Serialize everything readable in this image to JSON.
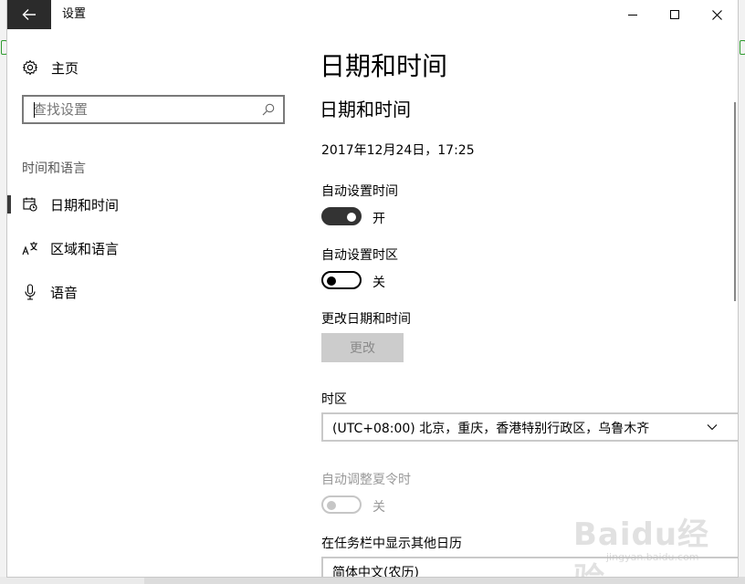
{
  "window": {
    "title": "设置"
  },
  "nav": {
    "home_label": "主页",
    "search_placeholder": "查找设置",
    "section_title": "时间和语言",
    "items": [
      {
        "label": "日期和时间",
        "selected": true,
        "icon": "calendar-clock-icon"
      },
      {
        "label": "区域和语言",
        "selected": false,
        "icon": "language-icon"
      },
      {
        "label": "语音",
        "selected": false,
        "icon": "microphone-icon"
      }
    ]
  },
  "main": {
    "page_title": "日期和时间",
    "section_title": "日期和时间",
    "current_datetime": "2017年12月24日，17:25",
    "auto_time": {
      "label": "自动设置时间",
      "state": "开",
      "on": true
    },
    "auto_timezone": {
      "label": "自动设置时区",
      "state": "关",
      "on": false
    },
    "change_datetime": {
      "label": "更改日期和时间",
      "button": "更改",
      "enabled": false
    },
    "timezone": {
      "label": "时区",
      "value": "(UTC+08:00) 北京，重庆，香港特别行政区，乌鲁木齐"
    },
    "dst": {
      "label": "自动调整夏令时",
      "state": "关",
      "enabled": false
    },
    "extra_calendar": {
      "label": "在任务栏中显示其他日历",
      "value": "简体中文(农历)"
    }
  },
  "watermark": {
    "logo_text": "Baidu经验",
    "url": "jingyan.baidu.com"
  },
  "colors": {
    "toggle_on": "#333333",
    "button_disabled_bg": "#cccccc",
    "title_back_bg": "#2b2b2b"
  }
}
